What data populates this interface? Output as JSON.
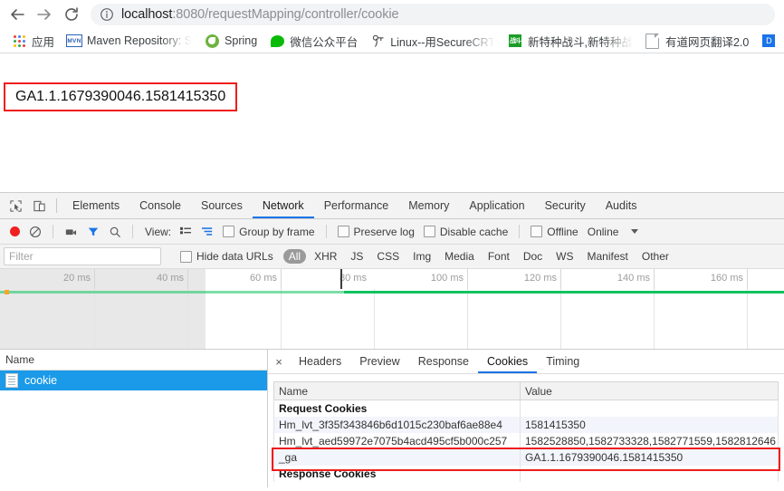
{
  "browser": {
    "nav": {
      "back_label": "Back",
      "forward_label": "Forward",
      "reload_label": "Reload"
    },
    "omnibox": {
      "info_icon": "info-circle-icon",
      "host": "localhost",
      "path": ":8080/requestMapping/controller/cookie",
      "url": "localhost:8080/requestMapping/controller/cookie"
    },
    "bookmarks": [
      {
        "label": "应用",
        "icon": "apps-grid-icon"
      },
      {
        "label": "Maven Repository: S",
        "icon": "maven-icon",
        "truncated": true
      },
      {
        "label": "Spring",
        "icon": "spring-leaf-icon"
      },
      {
        "label": "微信公众平台",
        "icon": "wechat-icon"
      },
      {
        "label": "Linux--用SecureCRT",
        "icon": "securecrt-icon",
        "truncated": true
      },
      {
        "label": "新特种战斗,新特种战",
        "icon": "green-square-icon",
        "truncated": true
      },
      {
        "label": "有道网页翻译2.0",
        "icon": "page-icon"
      },
      {
        "label": "",
        "icon": "blue-square-icon"
      }
    ]
  },
  "page": {
    "body_text": "GA1.1.1679390046.1581415350",
    "highlight_color": "#f01c1c"
  },
  "devtools": {
    "left_icons": [
      {
        "name": "inspect-element-icon"
      },
      {
        "name": "device-toolbar-icon"
      }
    ],
    "tabs": [
      {
        "label": "Elements",
        "active": false
      },
      {
        "label": "Console",
        "active": false
      },
      {
        "label": "Sources",
        "active": false
      },
      {
        "label": "Network",
        "active": true
      },
      {
        "label": "Performance",
        "active": false
      },
      {
        "label": "Memory",
        "active": false
      },
      {
        "label": "Application",
        "active": false
      },
      {
        "label": "Security",
        "active": false
      },
      {
        "label": "Audits",
        "active": false
      }
    ],
    "toolbar": {
      "record_label": "Record",
      "clear_label": "Clear",
      "screenshot_label": "Capture screenshots",
      "filter_label": "Filter",
      "search_label": "Search",
      "view_label": "View:",
      "view_list_icon": "list-view-icon",
      "view_waterfall_icon": "waterfall-view-icon",
      "checkboxes": [
        {
          "label": "Group by frame",
          "checked": false
        },
        {
          "label": "Preserve log",
          "checked": false
        },
        {
          "label": "Disable cache",
          "checked": false
        },
        {
          "label": "Offline",
          "checked": false
        }
      ],
      "throttle_value": "Online",
      "more_icon": "chevron-down-icon"
    },
    "filterbar": {
      "filter_placeholder": "Filter",
      "filter_value": "",
      "hide_data_urls_label": "Hide data URLs",
      "hide_data_urls_checked": false,
      "types": [
        {
          "label": "All",
          "selected": true
        },
        {
          "label": "XHR",
          "selected": false
        },
        {
          "label": "JS",
          "selected": false
        },
        {
          "label": "CSS",
          "selected": false
        },
        {
          "label": "Img",
          "selected": false
        },
        {
          "label": "Media",
          "selected": false
        },
        {
          "label": "Font",
          "selected": false
        },
        {
          "label": "Doc",
          "selected": false
        },
        {
          "label": "WS",
          "selected": false
        },
        {
          "label": "Manifest",
          "selected": false
        },
        {
          "label": "Other",
          "selected": false
        }
      ]
    },
    "timeline": {
      "ticks": [
        "20 ms",
        "40 ms",
        "60 ms",
        "80 ms",
        "100 ms",
        "120 ms",
        "140 ms",
        "160 ms"
      ],
      "unit": "ms",
      "interval": 20,
      "selection_end": "80 ms",
      "load_line_color": "#13c260",
      "dim_color": "rgba(0,0,0,0.09)"
    },
    "requests": {
      "column_header": "Name",
      "rows": [
        {
          "name": "cookie",
          "selected": true,
          "icon": "document-icon"
        }
      ]
    },
    "details": {
      "close_label": "×",
      "tabs": [
        {
          "label": "Headers",
          "active": false
        },
        {
          "label": "Preview",
          "active": false
        },
        {
          "label": "Response",
          "active": false
        },
        {
          "label": "Cookies",
          "active": true
        },
        {
          "label": "Timing",
          "active": false
        }
      ],
      "cookies_table": {
        "columns": [
          "Name",
          "Value"
        ],
        "rows": [
          {
            "kind": "group",
            "name": "Request Cookies",
            "value": ""
          },
          {
            "kind": "alt",
            "name": "Hm_lvt_3f35f343846b6d1015c230baf6ae88e4",
            "value": "1581415350"
          },
          {
            "kind": "plain",
            "name": "Hm_lvt_aed59972e7075b4acd495cf5b000c257",
            "value": "1582528850,1582733328,1582771559,1582812646"
          },
          {
            "kind": "alt",
            "name": "_ga",
            "value": "GA1.1.1679390046.1581415350",
            "highlighted": true
          },
          {
            "kind": "group",
            "name": "Response Cookies",
            "value": ""
          }
        ]
      }
    }
  }
}
